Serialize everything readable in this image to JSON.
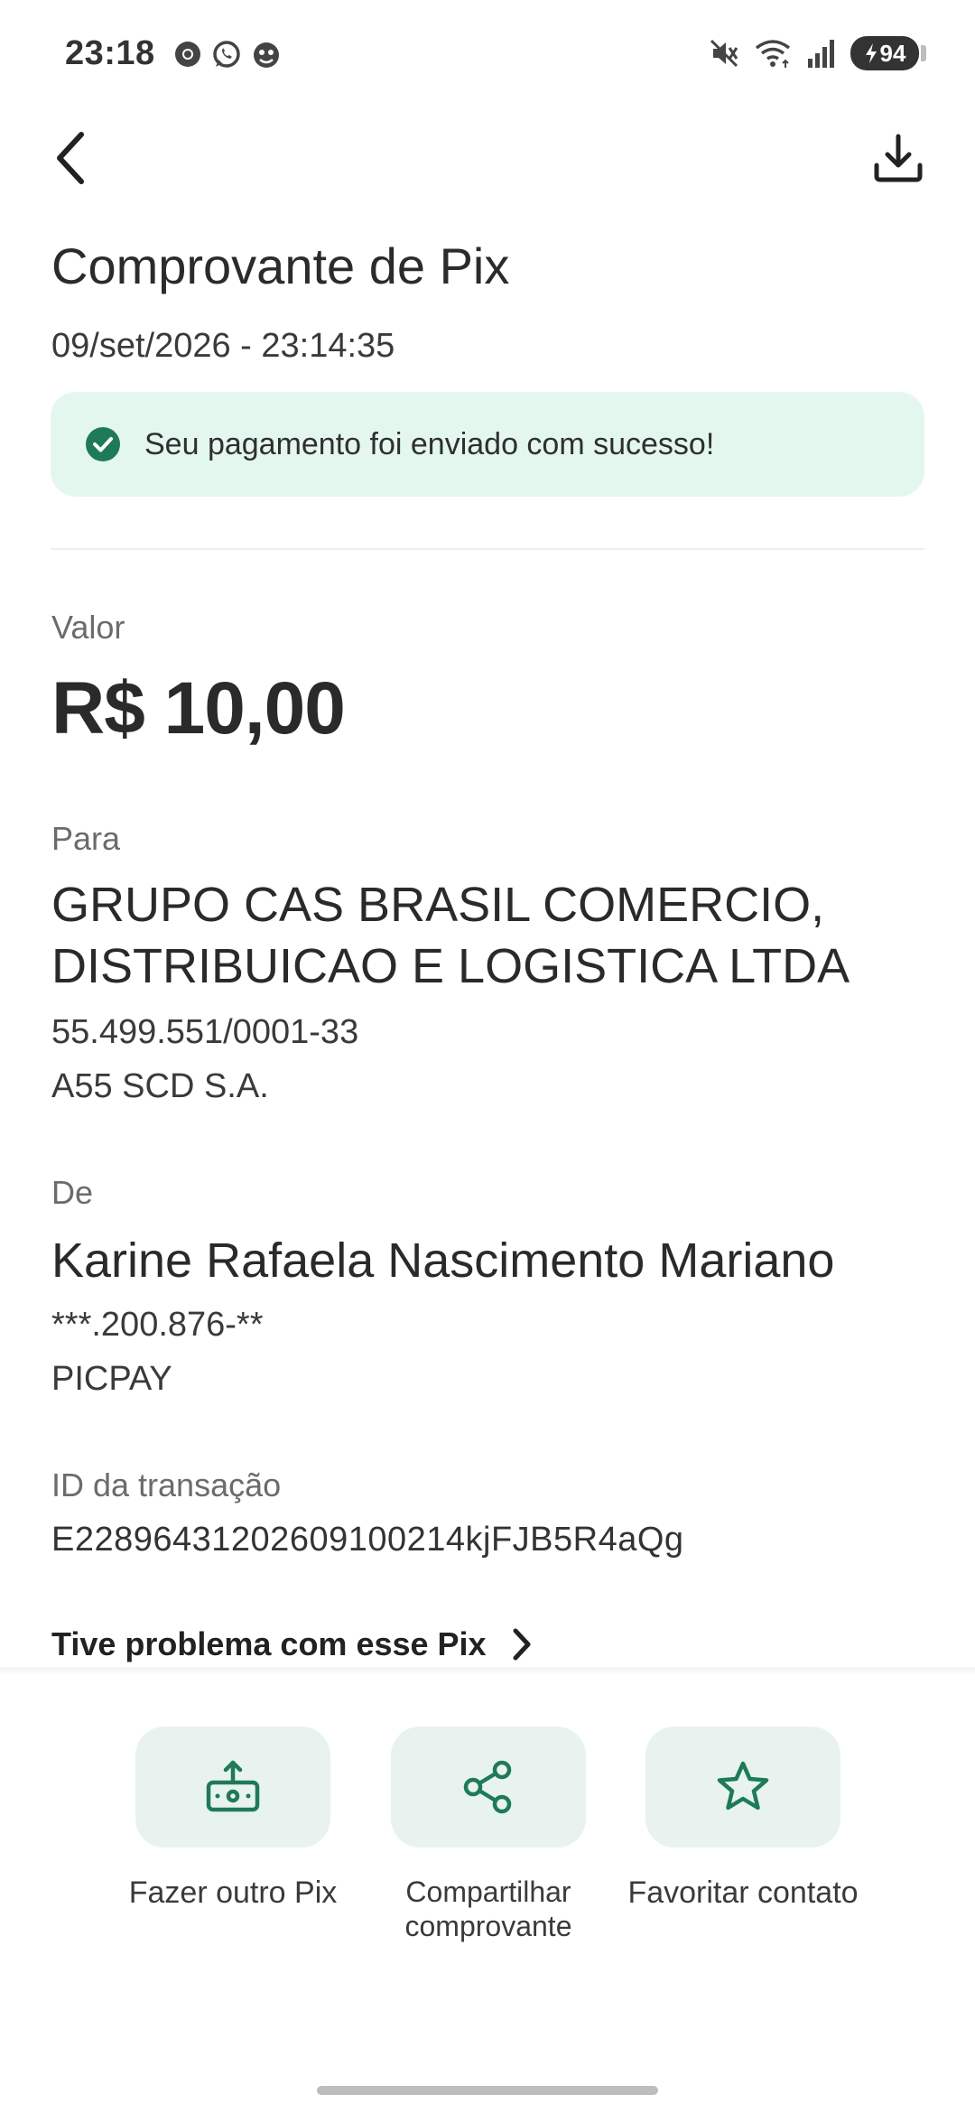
{
  "status_bar": {
    "time": "23:18",
    "battery": "94",
    "icons": [
      "chrome-icon",
      "whatsapp-icon",
      "app-icon",
      "mute-icon",
      "wifi-icon",
      "signal-icon",
      "battery-icon"
    ]
  },
  "header": {
    "title": "Comprovante de Pix",
    "datetime": "09/set/2026 - 23:14:35"
  },
  "success": {
    "message": "Seu pagamento foi enviado com sucesso!",
    "color": "#1f7a57",
    "background": "#e4f7ee"
  },
  "amount": {
    "label": "Valor",
    "value": "R$ 10,00"
  },
  "recipient": {
    "label": "Para",
    "name": "GRUPO CAS BRASIL COMERCIO, DISTRIBUICAO E LOGISTICA LTDA",
    "document": "55.499.551/0001-33",
    "bank": "A55 SCD S.A."
  },
  "sender": {
    "label": "De",
    "name": "Karine Rafaela Nascimento Mariano",
    "document": "***.200.876-**",
    "bank": "PICPAY"
  },
  "transaction": {
    "label": "ID da transação",
    "id": "E22896431202609100214kjFJB5R4aQg"
  },
  "problem_link": "Tive problema com esse Pix",
  "actions": [
    {
      "label": "Fazer outro Pix",
      "icon": "money-transfer-icon"
    },
    {
      "label": "Compartilhar comprovante",
      "icon": "share-icon"
    },
    {
      "label": "Favoritar contato",
      "icon": "star-icon"
    }
  ],
  "colors": {
    "accent": "#1f7a57",
    "tile_background": "#e8f3ef"
  }
}
